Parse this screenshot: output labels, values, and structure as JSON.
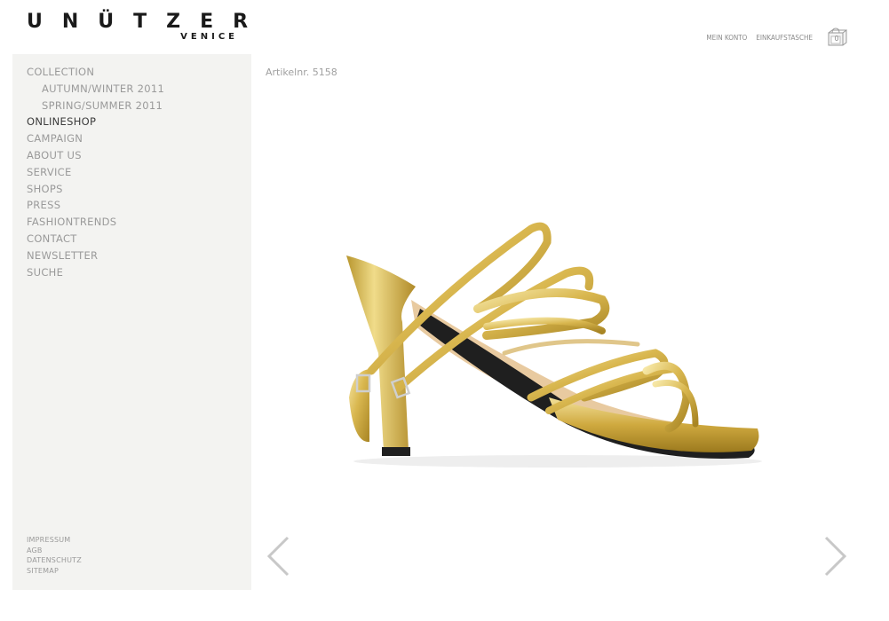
{
  "brand": {
    "name": "UNÜTZER",
    "sub": "VENICE"
  },
  "account": {
    "my_account": "MEIN KONTO",
    "shopping_bag": "EINKAUFSTASCHE",
    "bag_count": "0"
  },
  "sidebar": {
    "items": [
      {
        "label": "COLLECTION",
        "level": 0,
        "active": false
      },
      {
        "label": "AUTUMN/WINTER 2011",
        "level": 1,
        "active": false
      },
      {
        "label": "SPRING/SUMMER 2011",
        "level": 1,
        "active": false
      },
      {
        "label": "ONLINESHOP",
        "level": 0,
        "active": true
      },
      {
        "label": "CAMPAIGN",
        "level": 0,
        "active": false
      },
      {
        "label": "ABOUT US",
        "level": 0,
        "active": false
      },
      {
        "label": "SERVICE",
        "level": 0,
        "active": false
      },
      {
        "label": "SHOPS",
        "level": 0,
        "active": false
      },
      {
        "label": "PRESS",
        "level": 0,
        "active": false
      },
      {
        "label": "FASHIONTRENDS",
        "level": 0,
        "active": false
      },
      {
        "label": "CONTACT",
        "level": 0,
        "active": false
      },
      {
        "label": "NEWSLETTER",
        "level": 0,
        "active": false
      },
      {
        "label": "SUCHE",
        "level": 0,
        "active": false
      }
    ],
    "footer": [
      "IMPRESSUM",
      "AGB",
      "DATENSCHUTZ",
      "SITEMAP"
    ]
  },
  "product": {
    "article_number": "Artikelnr. 5158",
    "image_alt": "gold strappy high-heel sandal"
  },
  "colors": {
    "sidebar_bg": "#f3f3f1",
    "text_muted": "#9a9a9a",
    "text_active": "#3c3c3c",
    "gold": "#d4b24a"
  },
  "icons": {
    "bag": "shopping-bag-icon",
    "prev": "chevron-left-icon",
    "next": "chevron-right-icon"
  }
}
